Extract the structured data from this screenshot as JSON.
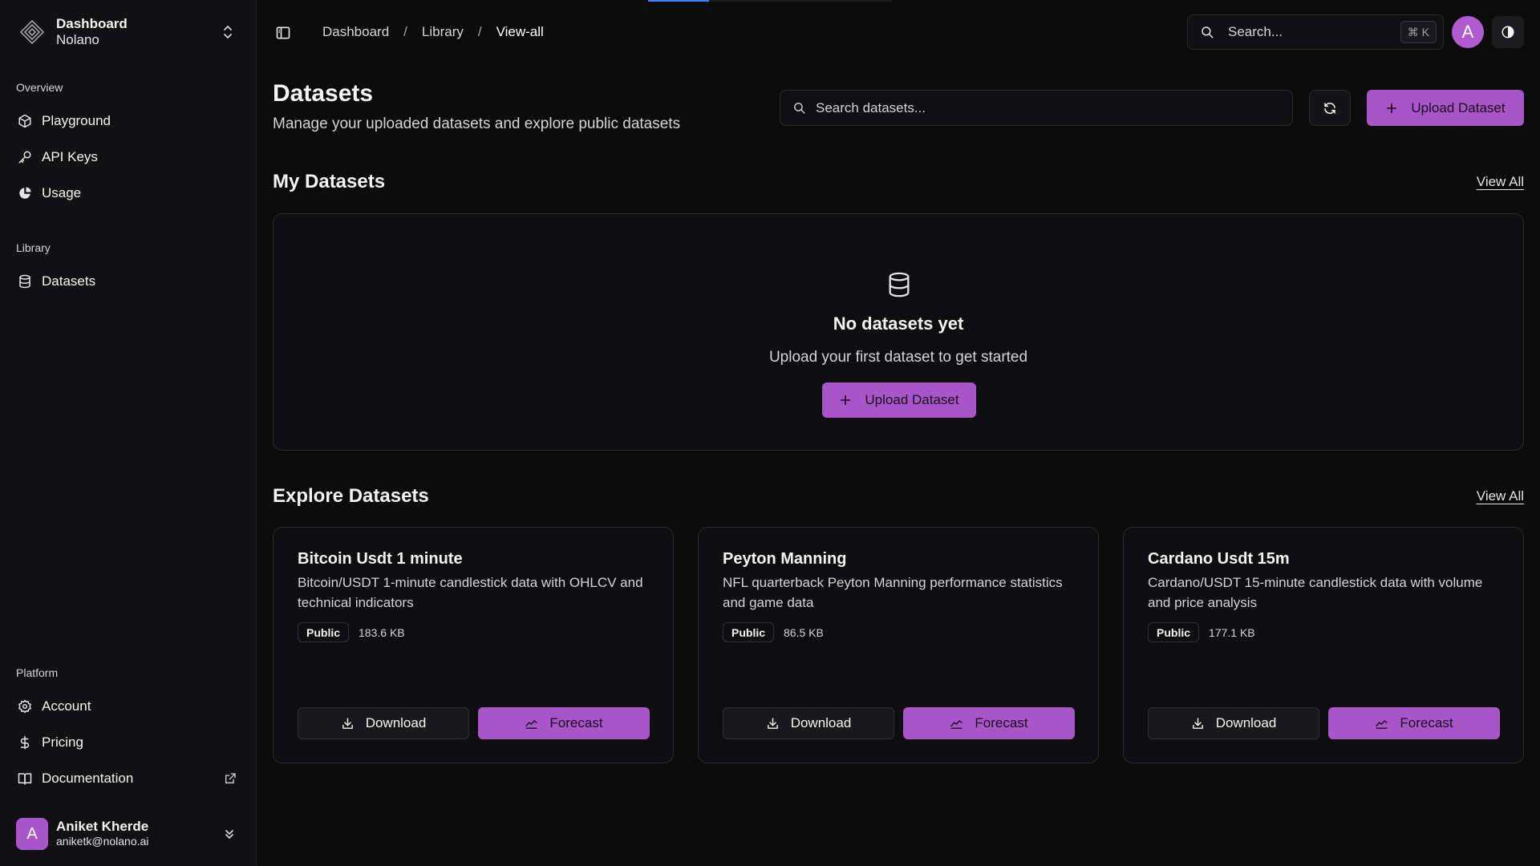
{
  "progress": {
    "fill_percent": 25
  },
  "sidebar": {
    "team": {
      "name": "Dashboard",
      "org": "Nolano"
    },
    "groups": {
      "overview": "Overview",
      "library": "Library",
      "platform": "Platform"
    },
    "items": {
      "playground": "Playground",
      "api_keys": "API Keys",
      "usage": "Usage",
      "datasets": "Datasets",
      "account": "Account",
      "pricing": "Pricing",
      "documentation": "Documentation"
    },
    "user": {
      "name": "Aniket Kherde",
      "email": "aniketk@nolano.ai",
      "initial": "A"
    }
  },
  "header": {
    "breadcrumbs": [
      "Dashboard",
      "Library",
      "View-all"
    ],
    "separator": "/",
    "search_placeholder": "Search...",
    "shortcut": "⌘ K",
    "avatar_initial": "A"
  },
  "main": {
    "title": "Datasets",
    "subtitle": "Manage your uploaded datasets and explore public datasets",
    "search_placeholder": "Search datasets...",
    "upload_label": "Upload Dataset",
    "my_datasets": {
      "title": "My Datasets",
      "view_all": "View All",
      "empty_title": "No datasets yet",
      "empty_subtitle": "Upload your first dataset to get started",
      "upload_label": "Upload Dataset"
    },
    "explore": {
      "title": "Explore Datasets",
      "view_all": "View All",
      "cards": [
        {
          "title": "Bitcoin Usdt 1 minute",
          "description": "Bitcoin/USDT 1-minute candlestick data with OHLCV and technical indicators",
          "badge": "Public",
          "size": "183.6 KB",
          "download": "Download",
          "forecast": "Forecast"
        },
        {
          "title": "Peyton Manning",
          "description": "NFL quarterback Peyton Manning performance statistics and game data",
          "badge": "Public",
          "size": "86.5 KB",
          "download": "Download",
          "forecast": "Forecast"
        },
        {
          "title": "Cardano Usdt 15m",
          "description": "Cardano/USDT 15-minute candlestick data with volume and price analysis",
          "badge": "Public",
          "size": "177.1 KB",
          "download": "Download",
          "forecast": "Forecast"
        }
      ]
    }
  },
  "colors": {
    "accent": "#a855c7",
    "background": "#0b0b0c",
    "sidebar": "#111113",
    "border": "#2a2a2e"
  }
}
